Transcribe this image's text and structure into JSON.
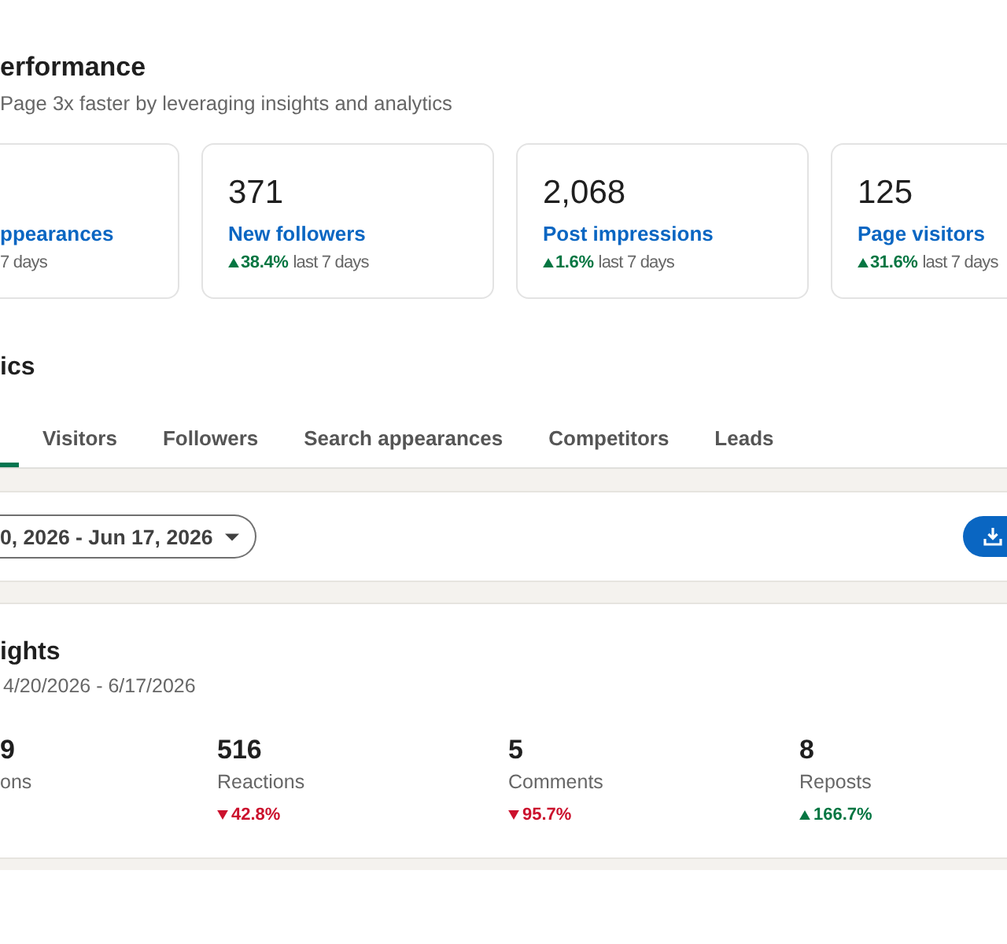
{
  "header": {
    "title": "erformance",
    "subtitle": "Page 3x faster by leveraging insights and analytics"
  },
  "metric_cards": [
    {
      "label": "ppearances",
      "period": "7 days"
    },
    {
      "value": "371",
      "label": "New followers",
      "change": "38.4%",
      "kind": "rise",
      "period": "last 7 days"
    },
    {
      "value": "2,068",
      "label": "Post impressions",
      "change": "1.6%",
      "kind": "rise",
      "period": "last 7 days"
    },
    {
      "value": "125",
      "label": "Page visitors",
      "change": "31.6%",
      "kind": "rise",
      "period": "last 7 days"
    }
  ],
  "analytics": {
    "title": "ics",
    "partial_tab": {
      "selected": true
    },
    "tabs": [
      {
        "label": "Visitors",
        "selected": false
      },
      {
        "label": "Followers",
        "selected": false
      },
      {
        "label": "Search appearances",
        "selected": false
      },
      {
        "label": "Competitors",
        "selected": false
      },
      {
        "label": "Leads",
        "selected": false
      }
    ]
  },
  "filter_bar": {
    "date_range": "0, 2026 - Jun 17, 2026"
  },
  "insights": {
    "title": "ights",
    "date_range": "4/20/2026 - 6/17/2026",
    "metrics": [
      {
        "value": "9",
        "label": "ons"
      },
      {
        "value": "516",
        "label": "Reactions",
        "change": "42.8%",
        "kind": "fall"
      },
      {
        "value": "5",
        "label": "Comments",
        "change": "95.7%",
        "kind": "fall"
      },
      {
        "value": "8",
        "label": "Reposts",
        "change": "166.7%",
        "kind": "rise"
      }
    ]
  }
}
